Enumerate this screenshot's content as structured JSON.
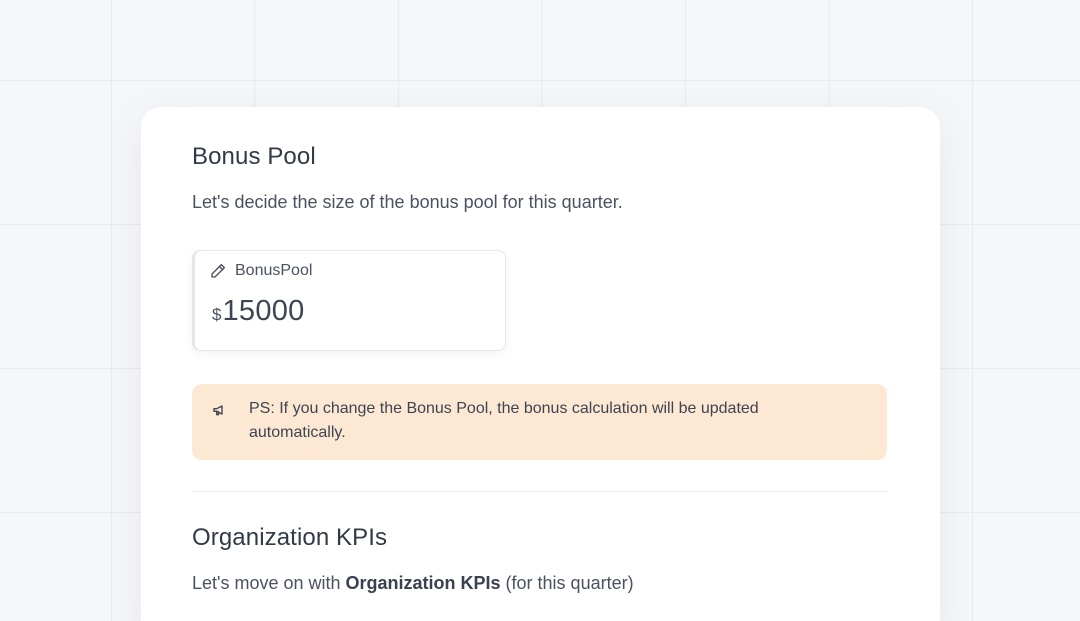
{
  "bonus_section": {
    "title": "Bonus Pool",
    "description": "Let's decide the size of the bonus pool for this quarter."
  },
  "bonus_input": {
    "label": "BonusPool",
    "currency_symbol": "$",
    "value": "15000",
    "icon": "pencil-icon"
  },
  "notice": {
    "icon": "megaphone-icon",
    "text": "PS: If you change the Bonus Pool, the bonus calculation will be updated automatically."
  },
  "kpi_section": {
    "title": "Organization KPIs",
    "description_prefix": "Let's move on with ",
    "description_bold": "Organization KPIs",
    "description_suffix": " (for this quarter)"
  },
  "colors": {
    "page_background": "#f5f6f9",
    "card_background": "#ffffff",
    "notice_background": "#fde8d3",
    "text_primary": "#323947"
  }
}
